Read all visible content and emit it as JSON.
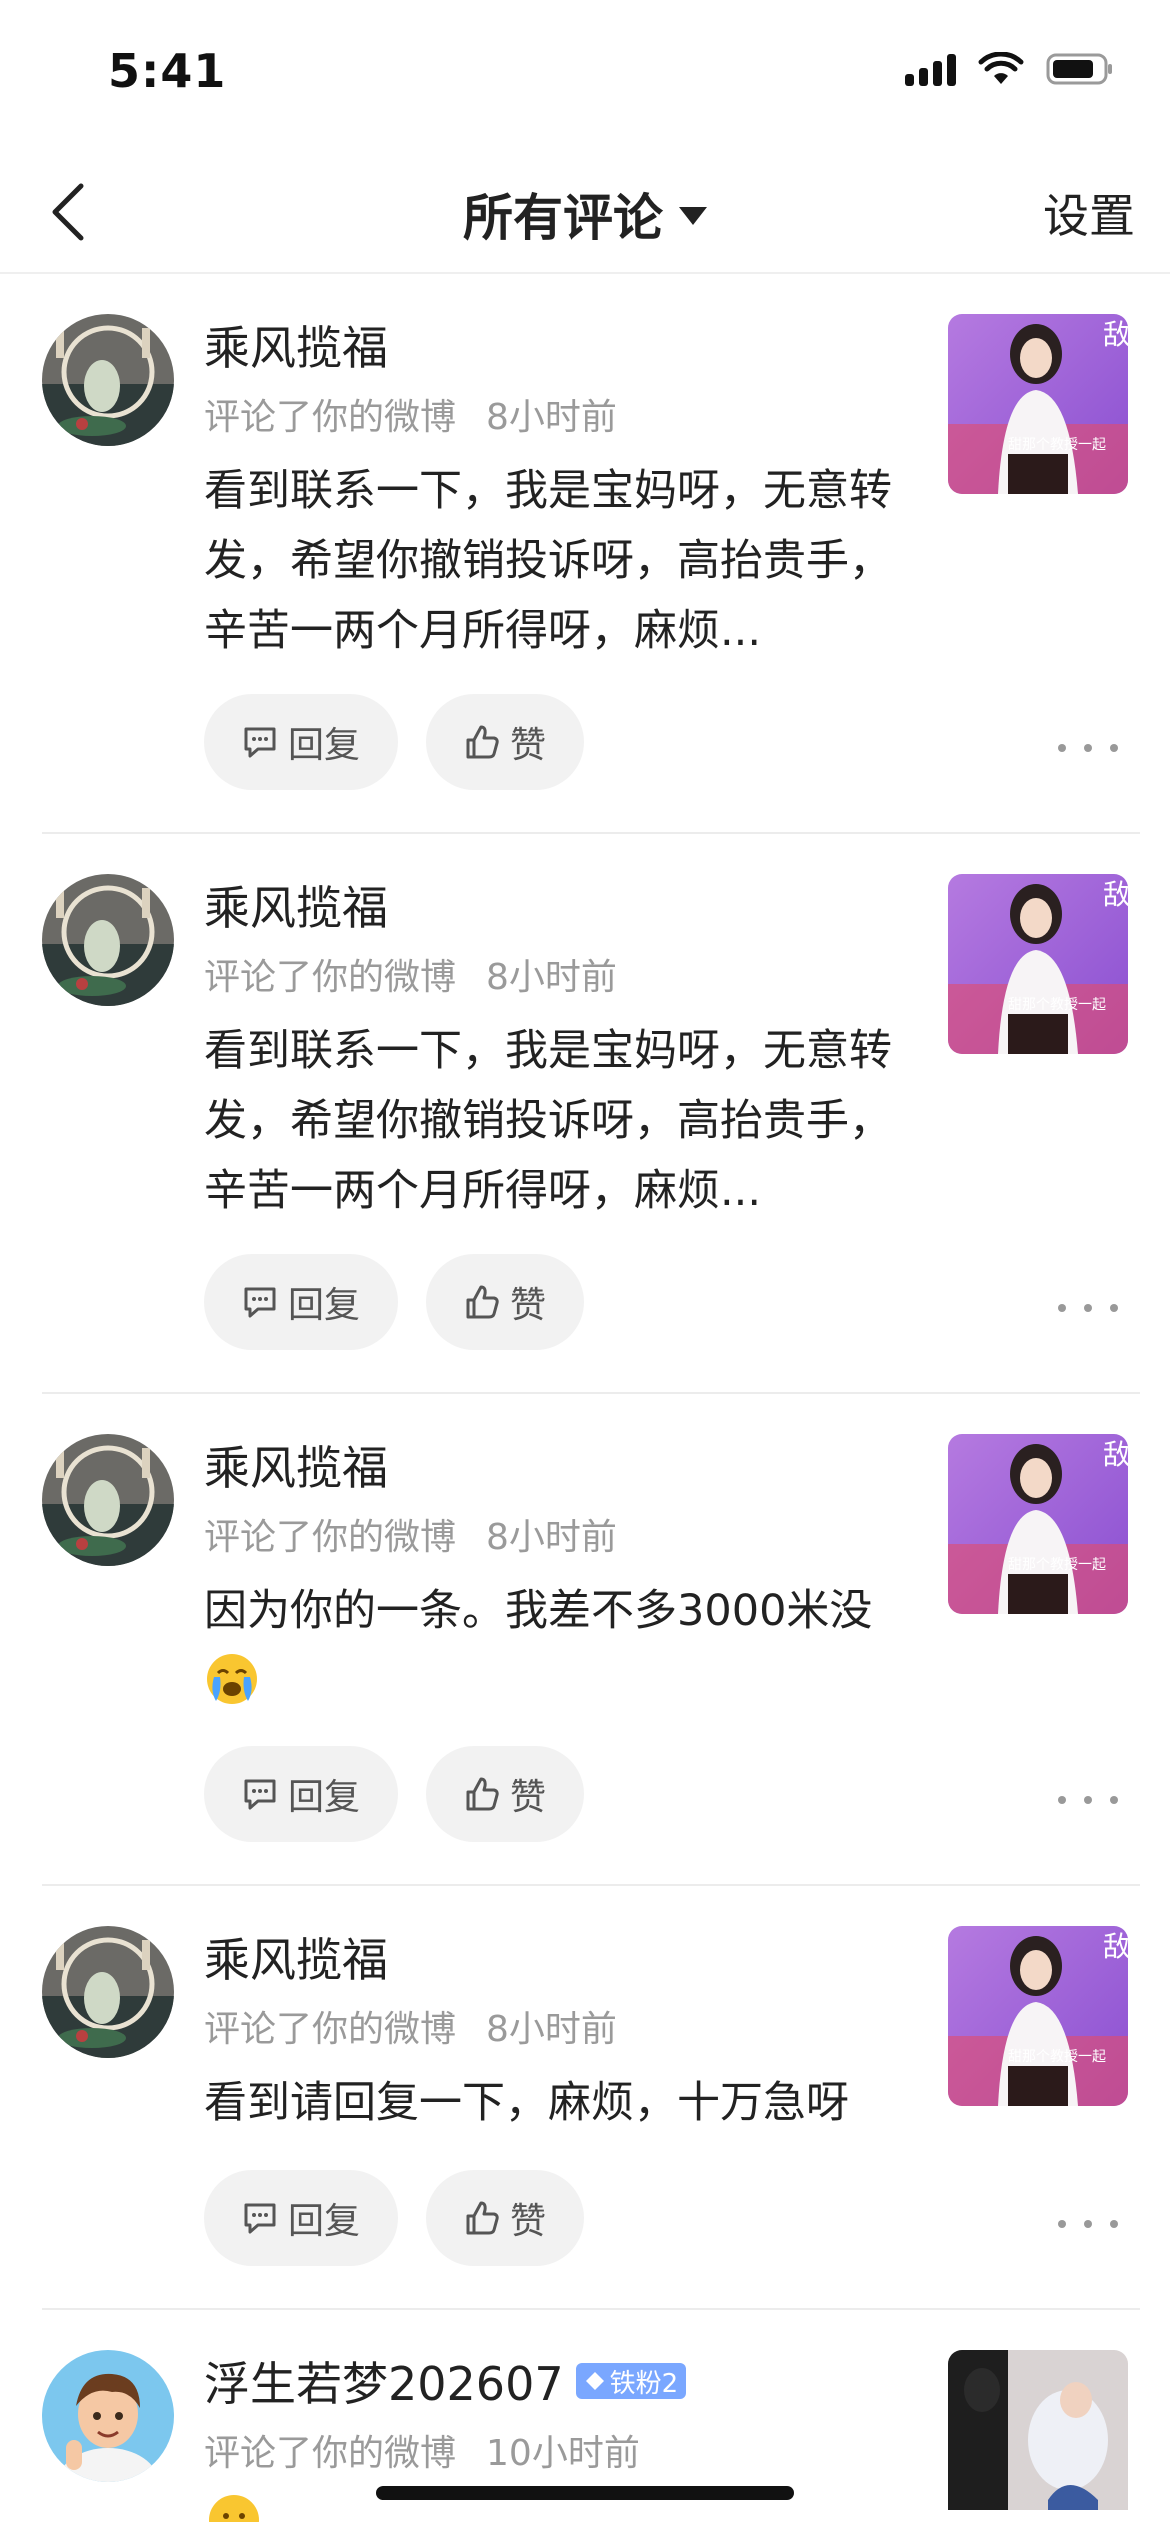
{
  "status_bar": {
    "time": "5:41"
  },
  "nav": {
    "title": "所有评论",
    "settings_label": "设置"
  },
  "actions": {
    "reply_label": "回复",
    "like_label": "赞"
  },
  "comments": [
    {
      "username": "乘风揽福",
      "action": "评论了你的微博",
      "time": "8小时前",
      "text": "看到联系一下，我是宝妈呀，无意转发，希望你撤销投诉呀，高抬贵手，辛苦一两个月所得呀，麻烦..."
    },
    {
      "username": "乘风揽福",
      "action": "评论了你的微博",
      "time": "8小时前",
      "text": "看到联系一下，我是宝妈呀，无意转发，希望你撤销投诉呀，高抬贵手，辛苦一两个月所得呀，麻烦..."
    },
    {
      "username": "乘风揽福",
      "action": "评论了你的微博",
      "time": "8小时前",
      "text": "因为你的一条。我差不多3000米没"
    },
    {
      "username": "乘风揽福",
      "action": "评论了你的微博",
      "time": "8小时前",
      "text": "看到请回复一下，麻烦，十万急呀"
    },
    {
      "username": "浮生若梦202607",
      "badge": "铁粉2",
      "action": "评论了你的微博",
      "time": "10小时前"
    }
  ],
  "thumbnail_caption": "甜那个教授一起",
  "thumbnail_corner": "敌"
}
